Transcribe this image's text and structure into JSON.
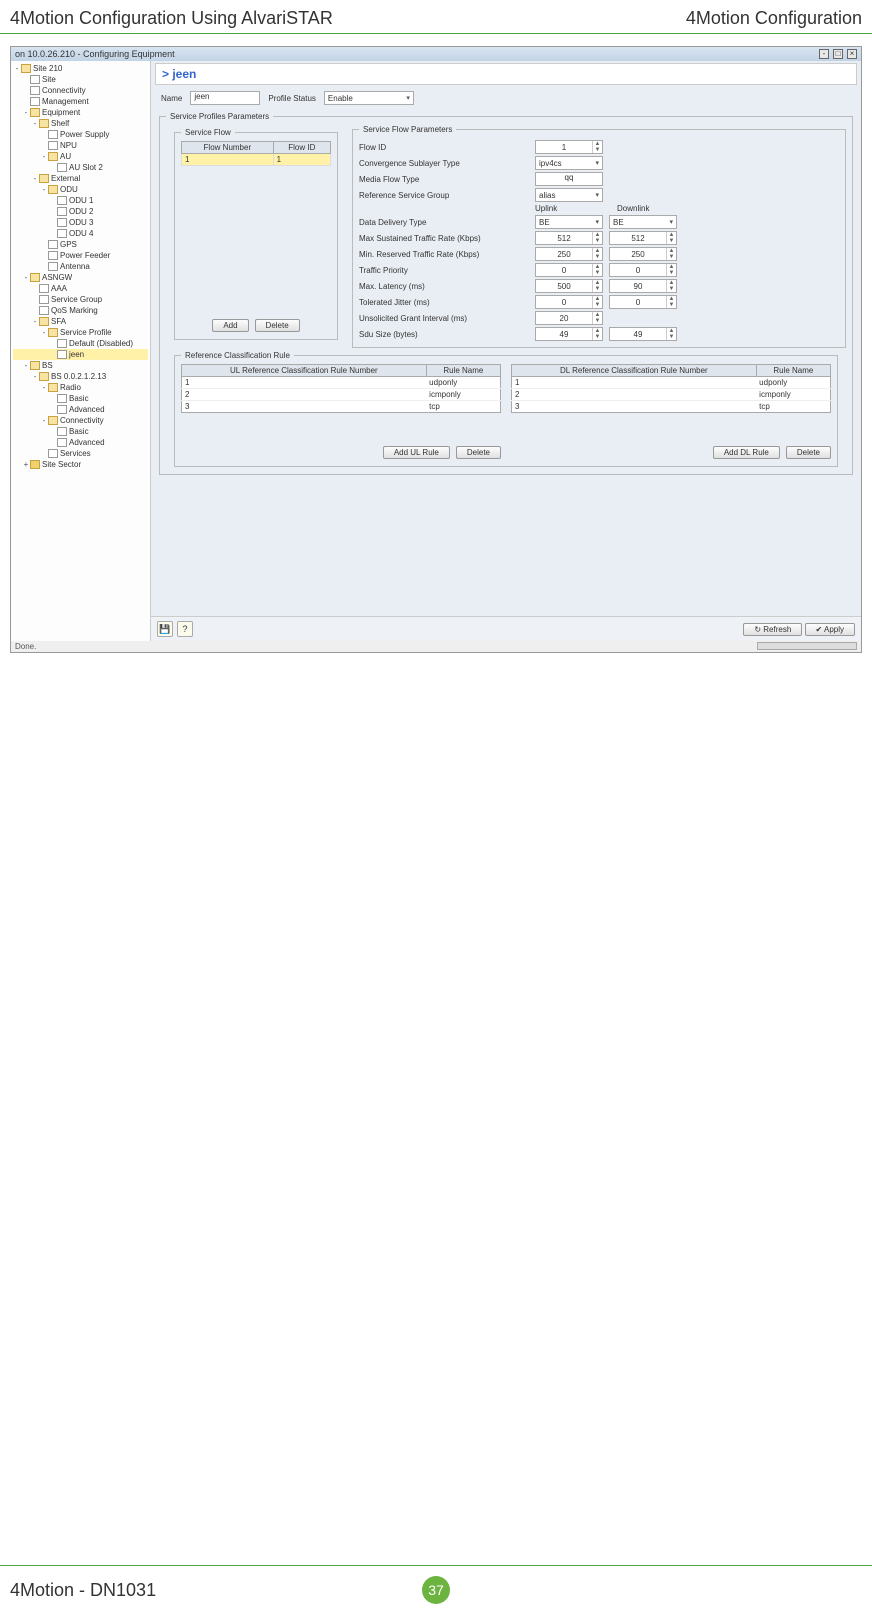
{
  "page": {
    "header_left": "4Motion Configuration Using AlvariSTAR",
    "header_right": "4Motion Configuration",
    "footer_left": "4Motion - DN1031",
    "page_number": "37"
  },
  "window": {
    "title": "on 10.0.26.210 - Configuring Equipment",
    "status": "Done."
  },
  "tree": [
    {
      "lvl": 0,
      "tog": "-",
      "icn": "fldopen",
      "label": "Site 210"
    },
    {
      "lvl": 1,
      "tog": "",
      "icn": "doc",
      "label": "Site"
    },
    {
      "lvl": 1,
      "tog": "",
      "icn": "doc",
      "label": "Connectivity"
    },
    {
      "lvl": 1,
      "tog": "",
      "icn": "doc",
      "label": "Management"
    },
    {
      "lvl": 1,
      "tog": "-",
      "icn": "fldopen",
      "label": "Equipment"
    },
    {
      "lvl": 2,
      "tog": "-",
      "icn": "fldopen",
      "label": "Shelf"
    },
    {
      "lvl": 3,
      "tog": "",
      "icn": "doc",
      "label": "Power Supply"
    },
    {
      "lvl": 3,
      "tog": "",
      "icn": "doc",
      "label": "NPU"
    },
    {
      "lvl": 3,
      "tog": "-",
      "icn": "fldopen",
      "label": "AU"
    },
    {
      "lvl": 4,
      "tog": "",
      "icn": "doc",
      "label": "AU Slot 2"
    },
    {
      "lvl": 2,
      "tog": "-",
      "icn": "fldopen",
      "label": "External"
    },
    {
      "lvl": 3,
      "tog": "-",
      "icn": "fldopen",
      "label": "ODU"
    },
    {
      "lvl": 4,
      "tog": "",
      "icn": "doc",
      "label": "ODU 1"
    },
    {
      "lvl": 4,
      "tog": "",
      "icn": "doc",
      "label": "ODU 2"
    },
    {
      "lvl": 4,
      "tog": "",
      "icn": "doc",
      "label": "ODU 3"
    },
    {
      "lvl": 4,
      "tog": "",
      "icn": "doc",
      "label": "ODU 4"
    },
    {
      "lvl": 3,
      "tog": "",
      "icn": "doc",
      "label": "GPS"
    },
    {
      "lvl": 3,
      "tog": "",
      "icn": "doc",
      "label": "Power Feeder"
    },
    {
      "lvl": 3,
      "tog": "",
      "icn": "doc",
      "label": "Antenna"
    },
    {
      "lvl": 1,
      "tog": "-",
      "icn": "fldopen",
      "label": "ASNGW"
    },
    {
      "lvl": 2,
      "tog": "",
      "icn": "doc",
      "label": "AAA"
    },
    {
      "lvl": 2,
      "tog": "",
      "icn": "doc",
      "label": "Service Group"
    },
    {
      "lvl": 2,
      "tog": "",
      "icn": "doc",
      "label": "QoS Marking"
    },
    {
      "lvl": 2,
      "tog": "-",
      "icn": "fldopen",
      "label": "SFA"
    },
    {
      "lvl": 3,
      "tog": "-",
      "icn": "fldopen",
      "label": "Service Profile"
    },
    {
      "lvl": 4,
      "tog": "",
      "icn": "doc",
      "label": "Default (Disabled)"
    },
    {
      "lvl": 4,
      "tog": "",
      "icn": "doc",
      "label": "jeen",
      "sel": true
    },
    {
      "lvl": 1,
      "tog": "-",
      "icn": "fldopen",
      "label": "BS"
    },
    {
      "lvl": 2,
      "tog": "-",
      "icn": "fldopen",
      "label": "BS 0.0.2.1.2.13"
    },
    {
      "lvl": 3,
      "tog": "-",
      "icn": "fldopen",
      "label": "Radio"
    },
    {
      "lvl": 4,
      "tog": "",
      "icn": "doc",
      "label": "Basic"
    },
    {
      "lvl": 4,
      "tog": "",
      "icn": "doc",
      "label": "Advanced"
    },
    {
      "lvl": 3,
      "tog": "-",
      "icn": "fldopen",
      "label": "Connectivity"
    },
    {
      "lvl": 4,
      "tog": "",
      "icn": "doc",
      "label": "Basic"
    },
    {
      "lvl": 4,
      "tog": "",
      "icn": "doc",
      "label": "Advanced"
    },
    {
      "lvl": 3,
      "tog": "",
      "icn": "doc",
      "label": "Services"
    },
    {
      "lvl": 1,
      "tog": "+",
      "icn": "fld",
      "label": "Site Sector"
    }
  ],
  "main": {
    "crumb": "jeen",
    "name_label": "Name",
    "name_value": "jeen",
    "profile_status_label": "Profile Status",
    "profile_status_value": "Enable",
    "spp_legend": "Service Profiles Parameters",
    "sf_legend": "Service Flow",
    "sf_headers": [
      "Flow Number",
      "Flow ID"
    ],
    "sf_rows": [
      {
        "num": "1",
        "id": "1"
      }
    ],
    "sfp_legend": "Service Flow Parameters",
    "params": {
      "flow_id_label": "Flow ID",
      "flow_id": "1",
      "cst_label": "Convergence Sublayer Type",
      "cst": "ipv4cs",
      "mft_label": "Media Flow Type",
      "mft": "qq",
      "rsg_label": "Reference Service Group",
      "rsg": "alias",
      "ul_hdr": "Uplink",
      "dl_hdr": "Downlink",
      "ddt_label": "Data Delivery Type",
      "ddt_ul": "BE",
      "ddt_dl": "BE",
      "mstr_label": "Max Sustained Traffic Rate (Kbps)",
      "mstr_ul": "512",
      "mstr_dl": "512",
      "mrtr_label": "Min. Reserved Traffic Rate (Kbps)",
      "mrtr_ul": "250",
      "mrtr_dl": "250",
      "tp_label": "Traffic Priority",
      "tp_ul": "0",
      "tp_dl": "0",
      "ml_label": "Max. Latency (ms)",
      "ml_ul": "500",
      "ml_dl": "90",
      "tj_label": "Tolerated Jitter (ms)",
      "tj_ul": "0",
      "tj_dl": "0",
      "ugi_label": "Unsolicited Grant Interval (ms)",
      "ugi_ul": "20",
      "sdu_label": "Sdu Size (bytes)",
      "sdu_ul": "49",
      "sdu_dl": "49"
    },
    "add_btn": "Add",
    "delete_btn": "Delete",
    "rcr_legend": "Reference Classification Rule",
    "ul_hdrs": [
      "UL Reference Classification Rule Number",
      "Rule Name"
    ],
    "dl_hdrs": [
      "DL Reference Classification Rule Number",
      "Rule Name"
    ],
    "ul_rows": [
      {
        "n": "1",
        "name": "udponly"
      },
      {
        "n": "2",
        "name": "icmponly"
      },
      {
        "n": "3",
        "name": "tcp"
      }
    ],
    "dl_rows": [
      {
        "n": "1",
        "name": "udponly"
      },
      {
        "n": "2",
        "name": "icmponly"
      },
      {
        "n": "3",
        "name": "tcp"
      }
    ],
    "add_ul": "Add UL Rule",
    "add_dl": "Add DL Rule",
    "refresh_btn": "Refresh",
    "apply_btn": "Apply"
  }
}
